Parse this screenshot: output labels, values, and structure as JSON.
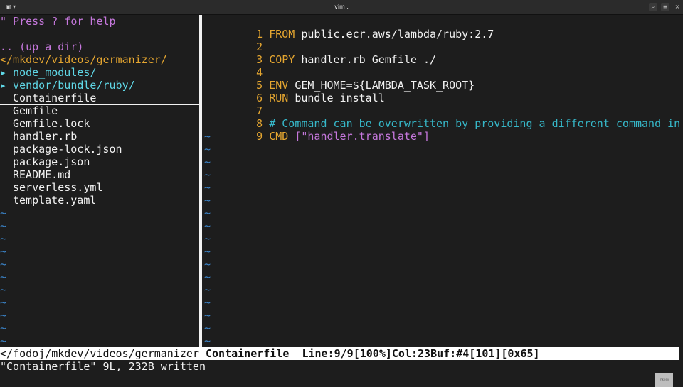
{
  "window": {
    "title": "vim ."
  },
  "titlebar_icons": {
    "left_menu": "▣ ▾",
    "search": "⌕",
    "menu": "≡",
    "close": "×"
  },
  "tree": {
    "help": "\" Press ? for help",
    "up_dir": ".. (up a dir)",
    "root": "</mkdev/videos/germanizer/",
    "dirs": [
      "▸ node_modules/",
      "▸ vendor/bundle/ruby/"
    ],
    "files": [
      "Containerfile",
      "Gemfile",
      "Gemfile.lock",
      "handler.rb",
      "package-lock.json",
      "package.json",
      "README.md",
      "serverless.yml",
      "template.yaml"
    ],
    "tilde": "~"
  },
  "editor": {
    "lines": [
      {
        "num": "1",
        "kw": "FROM",
        "rest": " public.ecr.aws/lambda/ruby:2.7"
      },
      {
        "num": "2",
        "kw": "",
        "rest": ""
      },
      {
        "num": "3",
        "kw": "COPY",
        "rest": " handler.rb Gemfile ./"
      },
      {
        "num": "4",
        "kw": "",
        "rest": ""
      },
      {
        "num": "5",
        "kw": "ENV",
        "rest": " GEM_HOME=${LAMBDA_TASK_ROOT}"
      },
      {
        "num": "6",
        "kw": "RUN",
        "rest": " bundle install"
      },
      {
        "num": "7",
        "kw": "",
        "rest": ""
      },
      {
        "num": "8",
        "comment": "# Command can be overwritten by providing a different command in the >"
      },
      {
        "num": "9",
        "kw": "CMD",
        "str": " [\"handler.translate\"]"
      }
    ],
    "tilde": "~"
  },
  "statusline": {
    "path": "</fodoj/mkdev/videos/germanizer ",
    "filename": "Containerfile",
    "position": "  Line:9/9[100%]Col:23Buf:#4[101][0x65]"
  },
  "cmdline": "\"Containerfile\" 9L, 232B written",
  "watermark": "mkdev"
}
